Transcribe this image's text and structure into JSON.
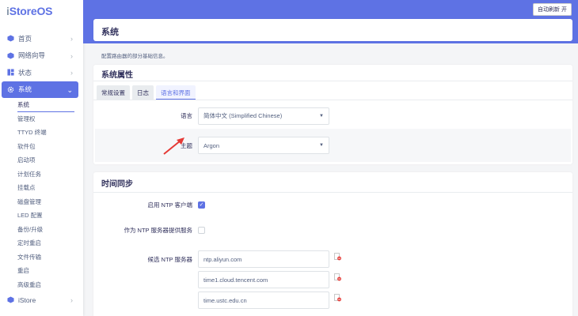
{
  "brand": {
    "prefix": "i",
    "rest": "StoreOS"
  },
  "header": {
    "auto_refresh": "自动刷新 开"
  },
  "sidebar": {
    "items": [
      {
        "label": "首页",
        "icon": "box-icon"
      },
      {
        "label": "网络向导",
        "icon": "box-icon"
      },
      {
        "label": "状态",
        "icon": "grid-icon"
      },
      {
        "label": "系统",
        "icon": "gear-icon"
      }
    ],
    "submenu": [
      "系统",
      "管理权",
      "TTYD 终端",
      "软件包",
      "启动项",
      "计划任务",
      "挂载点",
      "磁盘管理",
      "LED 配置",
      "备份/升级",
      "定时重启",
      "文件传输",
      "重启",
      "高级重启"
    ],
    "bottom_item": {
      "label": "iStore",
      "icon": "box-icon"
    }
  },
  "page": {
    "title": "系统",
    "description": "配置路由器的部分基础信息。"
  },
  "system_props": {
    "heading": "系统属性",
    "tabs": [
      "常规设置",
      "日志",
      "语言和界面"
    ],
    "active_tab": 2,
    "language": {
      "label": "语言",
      "value": "简体中文 (Simplified Chinese)"
    },
    "theme": {
      "label": "主题",
      "value": "Argon"
    }
  },
  "time_sync": {
    "heading": "时间同步",
    "ntp_client": {
      "label": "启用 NTP 客户端",
      "checked": true
    },
    "ntp_server": {
      "label": "作为 NTP 服务器提供服务",
      "checked": false
    },
    "candidates": {
      "label": "候选 NTP 服务器",
      "servers": [
        "ntp.aliyun.com",
        "time1.cloud.tencent.com",
        "time.ustc.edu.cn"
      ]
    }
  },
  "colors": {
    "accent": "#5e72e4",
    "arrow": "#e53935",
    "delete": "#e53935"
  }
}
